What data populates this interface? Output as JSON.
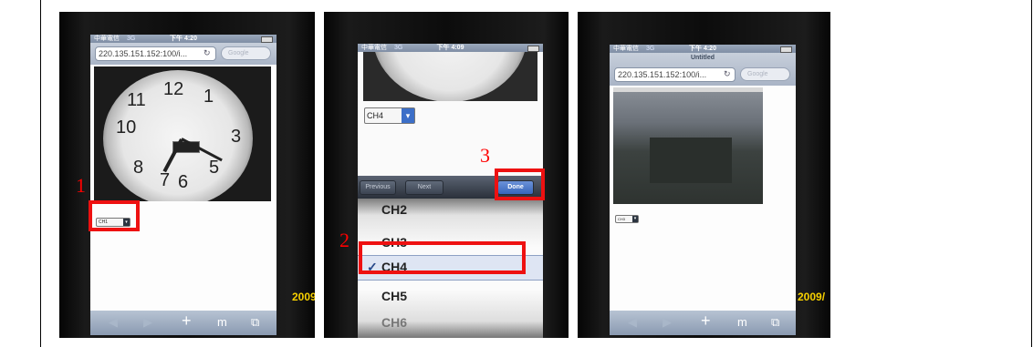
{
  "photos": [
    {
      "status": {
        "carrier": "中華電信",
        "network": "3G",
        "time": "下午 4:20"
      },
      "url": "220.135.151.152:100/i...",
      "search_placeholder": "Google",
      "channel_select": "CH1",
      "date_stamp": "2009",
      "callout_number": "1"
    },
    {
      "status": {
        "carrier": "中華電信",
        "network": "3G",
        "time": "下午 4:09"
      },
      "channel_select": "CH4",
      "form_nav": {
        "previous": "Previous",
        "next": "Next",
        "done": "Done"
      },
      "picker_items": [
        "CH2",
        "CH3",
        "CH4",
        "CH5",
        "CH6"
      ],
      "picker_selected": "CH4",
      "selected_check": "✓",
      "callout_done": "3",
      "callout_picker": "2"
    },
    {
      "status": {
        "carrier": "中華電信",
        "network": "3G",
        "time": "下午 4:20"
      },
      "page_title": "Untitled",
      "url": "220.135.151.152:100/i...",
      "search_placeholder": "Google",
      "channel_select": "CH3",
      "date_stamp": "2009/"
    }
  ],
  "toolbar_icons": [
    "back-arrow-icon",
    "forward-arrow-icon",
    "plus-icon",
    "bookmarks-icon",
    "pages-icon"
  ],
  "colors": {
    "highlight_red": "#ee1111",
    "date_yellow": "#f7d000"
  }
}
